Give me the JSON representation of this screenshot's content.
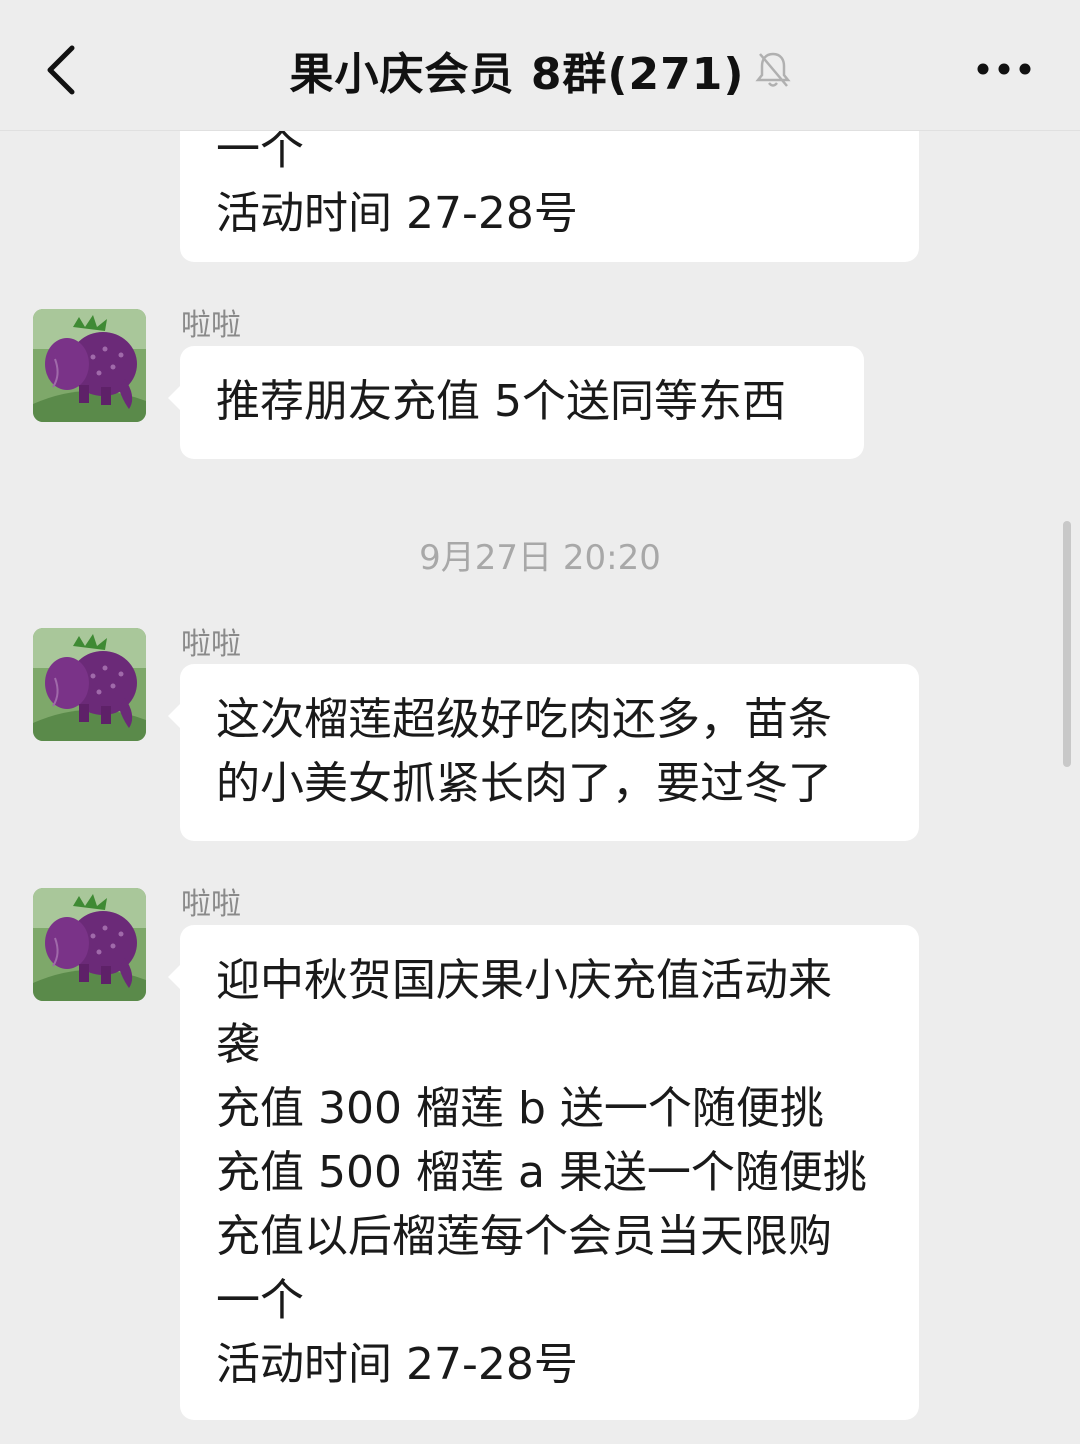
{
  "header": {
    "title": "果小庆会员 8群(271)",
    "back_icon": "chevron-left-icon",
    "mute_icon": "bell-off-icon",
    "more_icon": "more-dots-icon"
  },
  "messages": [
    {
      "sender": "",
      "lines": [
        "一个",
        "活动时间 27-28号"
      ]
    },
    {
      "sender": "啦啦",
      "lines": [
        "推荐朋友充值 5个送同等东西"
      ]
    },
    {
      "sender": "啦啦",
      "lines": [
        "这次榴莲超级好吃肉还多，苗条",
        "的小美女抓紧长肉了，要过冬了"
      ]
    },
    {
      "sender": "啦啦",
      "lines": [
        "迎中秋贺国庆果小庆充值活动来",
        "袭",
        "充值 300 榴莲 b 送一个随便挑",
        "充值 500 榴莲 a 果送一个随便挑",
        "充值以后榴莲每个会员当天限购",
        "一个",
        "活动时间 27-28号"
      ]
    }
  ],
  "timestamp": "9月27日 20:20",
  "colors": {
    "background": "#ededed",
    "bubble": "#ffffff",
    "secondary_text": "#8a8a8a",
    "timestamp_text": "#a8a8a8"
  }
}
